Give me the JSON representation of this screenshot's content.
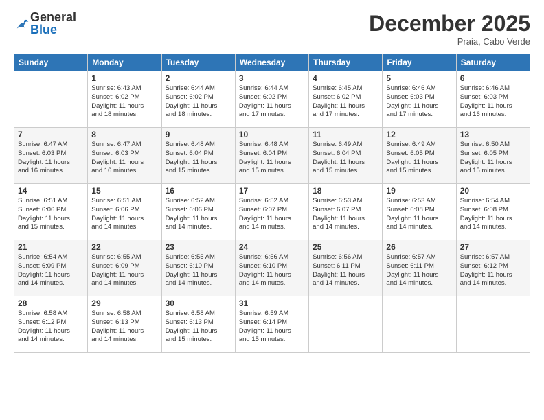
{
  "header": {
    "logo_general": "General",
    "logo_blue": "Blue",
    "month_title": "December 2025",
    "subtitle": "Praia, Cabo Verde"
  },
  "weekdays": [
    "Sunday",
    "Monday",
    "Tuesday",
    "Wednesday",
    "Thursday",
    "Friday",
    "Saturday"
  ],
  "weeks": [
    [
      {
        "day": "",
        "info": ""
      },
      {
        "day": "1",
        "info": "Sunrise: 6:43 AM\nSunset: 6:02 PM\nDaylight: 11 hours\nand 18 minutes."
      },
      {
        "day": "2",
        "info": "Sunrise: 6:44 AM\nSunset: 6:02 PM\nDaylight: 11 hours\nand 18 minutes."
      },
      {
        "day": "3",
        "info": "Sunrise: 6:44 AM\nSunset: 6:02 PM\nDaylight: 11 hours\nand 17 minutes."
      },
      {
        "day": "4",
        "info": "Sunrise: 6:45 AM\nSunset: 6:02 PM\nDaylight: 11 hours\nand 17 minutes."
      },
      {
        "day": "5",
        "info": "Sunrise: 6:46 AM\nSunset: 6:03 PM\nDaylight: 11 hours\nand 17 minutes."
      },
      {
        "day": "6",
        "info": "Sunrise: 6:46 AM\nSunset: 6:03 PM\nDaylight: 11 hours\nand 16 minutes."
      }
    ],
    [
      {
        "day": "7",
        "info": "Sunrise: 6:47 AM\nSunset: 6:03 PM\nDaylight: 11 hours\nand 16 minutes."
      },
      {
        "day": "8",
        "info": "Sunrise: 6:47 AM\nSunset: 6:03 PM\nDaylight: 11 hours\nand 16 minutes."
      },
      {
        "day": "9",
        "info": "Sunrise: 6:48 AM\nSunset: 6:04 PM\nDaylight: 11 hours\nand 15 minutes."
      },
      {
        "day": "10",
        "info": "Sunrise: 6:48 AM\nSunset: 6:04 PM\nDaylight: 11 hours\nand 15 minutes."
      },
      {
        "day": "11",
        "info": "Sunrise: 6:49 AM\nSunset: 6:04 PM\nDaylight: 11 hours\nand 15 minutes."
      },
      {
        "day": "12",
        "info": "Sunrise: 6:49 AM\nSunset: 6:05 PM\nDaylight: 11 hours\nand 15 minutes."
      },
      {
        "day": "13",
        "info": "Sunrise: 6:50 AM\nSunset: 6:05 PM\nDaylight: 11 hours\nand 15 minutes."
      }
    ],
    [
      {
        "day": "14",
        "info": "Sunrise: 6:51 AM\nSunset: 6:06 PM\nDaylight: 11 hours\nand 15 minutes."
      },
      {
        "day": "15",
        "info": "Sunrise: 6:51 AM\nSunset: 6:06 PM\nDaylight: 11 hours\nand 14 minutes."
      },
      {
        "day": "16",
        "info": "Sunrise: 6:52 AM\nSunset: 6:06 PM\nDaylight: 11 hours\nand 14 minutes."
      },
      {
        "day": "17",
        "info": "Sunrise: 6:52 AM\nSunset: 6:07 PM\nDaylight: 11 hours\nand 14 minutes."
      },
      {
        "day": "18",
        "info": "Sunrise: 6:53 AM\nSunset: 6:07 PM\nDaylight: 11 hours\nand 14 minutes."
      },
      {
        "day": "19",
        "info": "Sunrise: 6:53 AM\nSunset: 6:08 PM\nDaylight: 11 hours\nand 14 minutes."
      },
      {
        "day": "20",
        "info": "Sunrise: 6:54 AM\nSunset: 6:08 PM\nDaylight: 11 hours\nand 14 minutes."
      }
    ],
    [
      {
        "day": "21",
        "info": "Sunrise: 6:54 AM\nSunset: 6:09 PM\nDaylight: 11 hours\nand 14 minutes."
      },
      {
        "day": "22",
        "info": "Sunrise: 6:55 AM\nSunset: 6:09 PM\nDaylight: 11 hours\nand 14 minutes."
      },
      {
        "day": "23",
        "info": "Sunrise: 6:55 AM\nSunset: 6:10 PM\nDaylight: 11 hours\nand 14 minutes."
      },
      {
        "day": "24",
        "info": "Sunrise: 6:56 AM\nSunset: 6:10 PM\nDaylight: 11 hours\nand 14 minutes."
      },
      {
        "day": "25",
        "info": "Sunrise: 6:56 AM\nSunset: 6:11 PM\nDaylight: 11 hours\nand 14 minutes."
      },
      {
        "day": "26",
        "info": "Sunrise: 6:57 AM\nSunset: 6:11 PM\nDaylight: 11 hours\nand 14 minutes."
      },
      {
        "day": "27",
        "info": "Sunrise: 6:57 AM\nSunset: 6:12 PM\nDaylight: 11 hours\nand 14 minutes."
      }
    ],
    [
      {
        "day": "28",
        "info": "Sunrise: 6:58 AM\nSunset: 6:12 PM\nDaylight: 11 hours\nand 14 minutes."
      },
      {
        "day": "29",
        "info": "Sunrise: 6:58 AM\nSunset: 6:13 PM\nDaylight: 11 hours\nand 14 minutes."
      },
      {
        "day": "30",
        "info": "Sunrise: 6:58 AM\nSunset: 6:13 PM\nDaylight: 11 hours\nand 15 minutes."
      },
      {
        "day": "31",
        "info": "Sunrise: 6:59 AM\nSunset: 6:14 PM\nDaylight: 11 hours\nand 15 minutes."
      },
      {
        "day": "",
        "info": ""
      },
      {
        "day": "",
        "info": ""
      },
      {
        "day": "",
        "info": ""
      }
    ]
  ]
}
